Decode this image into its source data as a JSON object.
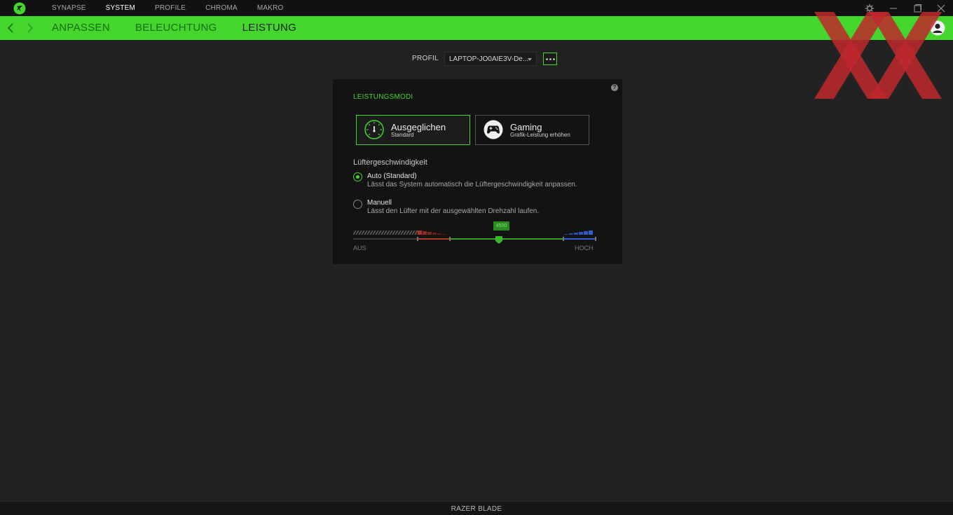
{
  "topnav": {
    "items": [
      {
        "label": "SYNAPSE"
      },
      {
        "label": "SYSTEM"
      },
      {
        "label": "PROFILE"
      },
      {
        "label": "CHROMA"
      },
      {
        "label": "MAKRO"
      }
    ],
    "active_index": 1,
    "icons": [
      "razer-logo-icon",
      "settings-icon",
      "minimize-icon",
      "maximize-icon",
      "close-icon"
    ]
  },
  "subnav": {
    "items": [
      {
        "label": "ANPASSEN"
      },
      {
        "label": "BELEUCHTUNG"
      },
      {
        "label": "LEISTUNG"
      }
    ],
    "active_index": 2
  },
  "profile": {
    "label": "PROFIL",
    "selected": "LAPTOP-JO0AIE3V-De..."
  },
  "performance": {
    "title": "LEISTUNGSMODI",
    "modes": [
      {
        "title": "Ausgeglichen",
        "subtitle": "Standard",
        "icon": "speedometer-icon",
        "active": true
      },
      {
        "title": "Gaming",
        "subtitle": "Grafik-Leistung erhöhen",
        "icon": "gamepad-icon",
        "active": false
      }
    ],
    "fan": {
      "title": "Lüftergeschwindigkeit",
      "options": [
        {
          "title": "Auto (Standard)",
          "desc": "Lässt das System automatisch die Lüftergeschwindigkeit anpassen.",
          "selected": true
        },
        {
          "title": "Manuell",
          "desc": "Lässt den Lüfter mit der ausgewählten Drehzahl laufen.",
          "selected": false
        }
      ],
      "slider": {
        "value": "4500",
        "min_label": "AUS",
        "max_label": "HOCH"
      }
    }
  },
  "footer": {
    "device": "RAZER BLADE"
  },
  "colors": {
    "accent": "#44d62c",
    "background": "#222222",
    "card": "#131313",
    "slider_red": "#c0392b",
    "slider_blue": "#2f5fd0"
  }
}
